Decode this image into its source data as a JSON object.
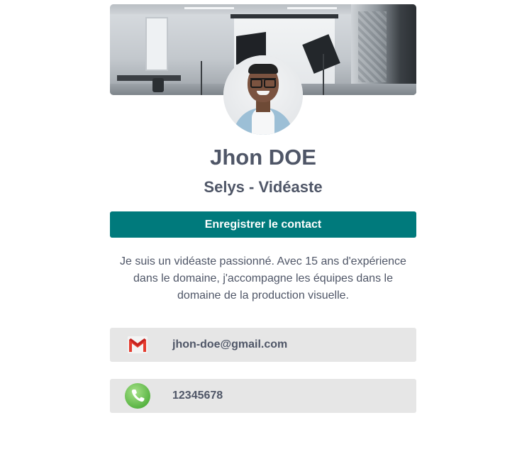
{
  "profile": {
    "name": "Jhon DOE",
    "subtitle": "Selys - Vidéaste",
    "save_label": "Enregistrer le contact",
    "bio_lines": [
      "Je suis un vidéaste passionné. Avec 15 ans d'expérience",
      "dans le domaine, j'accompagne les équipes dans le",
      "domaine de la production visuelle."
    ]
  },
  "contacts": [
    {
      "type": "email",
      "icon": "gmail-icon",
      "value": "jhon-doe@gmail.com"
    },
    {
      "type": "phone",
      "icon": "phone-icon",
      "value": "12345678"
    }
  ],
  "colors": {
    "accent": "#007a7c",
    "text": "#4f5667",
    "row_bg": "#e6e6e6"
  }
}
